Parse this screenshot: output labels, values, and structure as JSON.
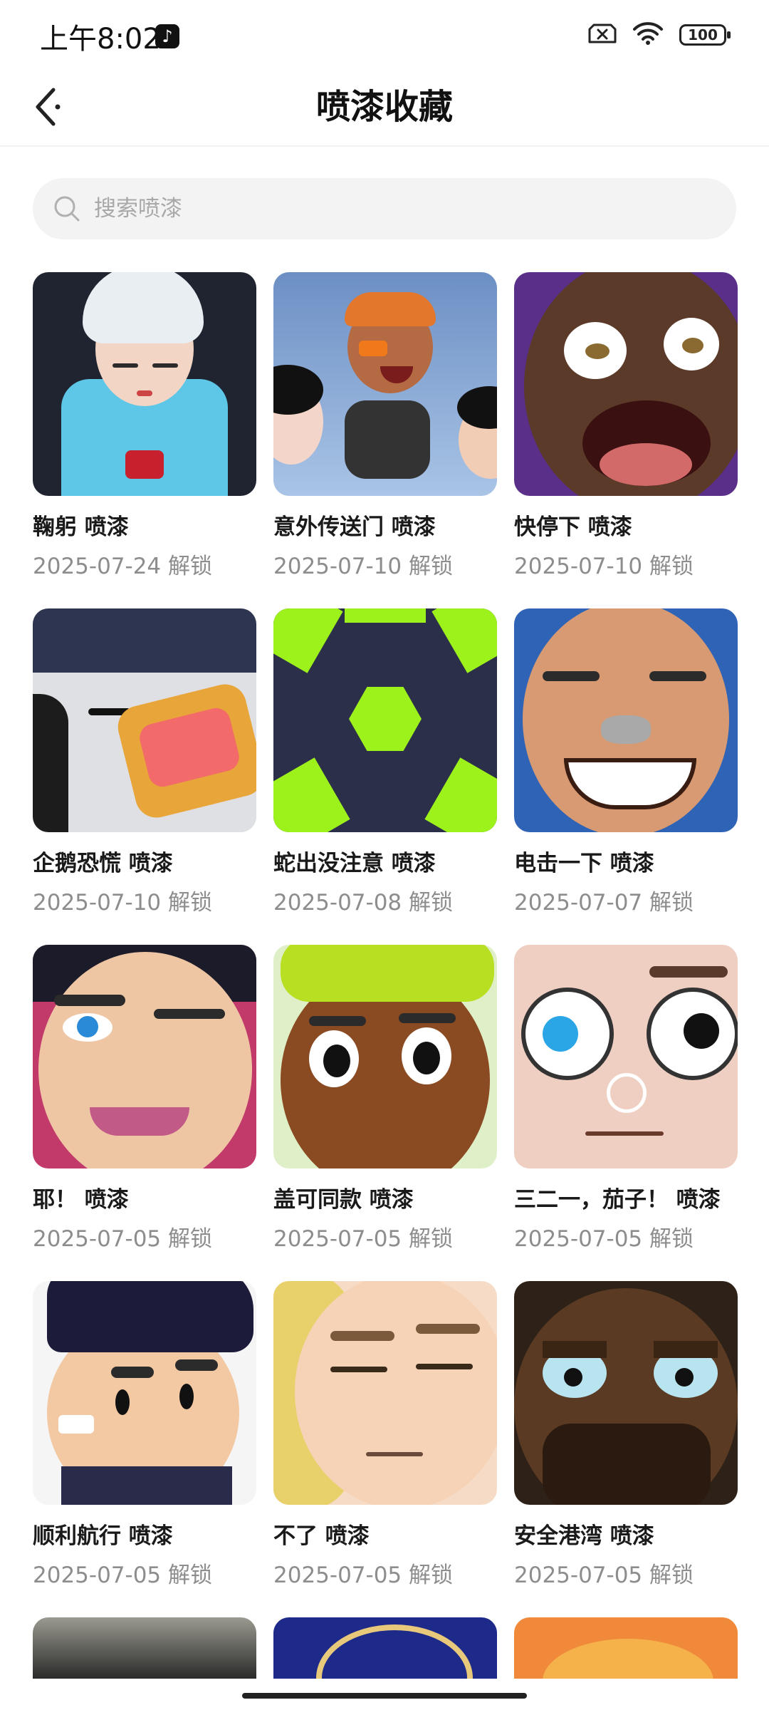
{
  "status": {
    "time": "上午8:02",
    "battery": "100"
  },
  "header": {
    "title": "喷漆收藏"
  },
  "search": {
    "placeholder": "搜索喷漆"
  },
  "colors": {
    "accent": "#111111",
    "muted": "#8d8d8d",
    "search_bg": "#f3f3f3"
  },
  "sprays": [
    {
      "name": "鞠躬 喷漆",
      "date": "2025-07-24 解锁"
    },
    {
      "name": "意外传送门 喷漆",
      "date": "2025-07-10 解锁"
    },
    {
      "name": "快停下 喷漆",
      "date": "2025-07-10 解锁"
    },
    {
      "name": "企鹅恐慌 喷漆",
      "date": "2025-07-10 解锁"
    },
    {
      "name": "蛇出没注意 喷漆",
      "date": "2025-07-08 解锁"
    },
    {
      "name": "电击一下 喷漆",
      "date": "2025-07-07 解锁"
    },
    {
      "name": "耶！ 喷漆",
      "date": "2025-07-05 解锁"
    },
    {
      "name": "盖可同款 喷漆",
      "date": "2025-07-05 解锁"
    },
    {
      "name": "三二一，茄子！ 喷漆",
      "date": "2025-07-05 解锁"
    },
    {
      "name": "顺利航行 喷漆",
      "date": "2025-07-05 解锁"
    },
    {
      "name": "不了 喷漆",
      "date": "2025-07-05 解锁"
    },
    {
      "name": "安全港湾 喷漆",
      "date": "2025-07-05 解锁"
    }
  ]
}
